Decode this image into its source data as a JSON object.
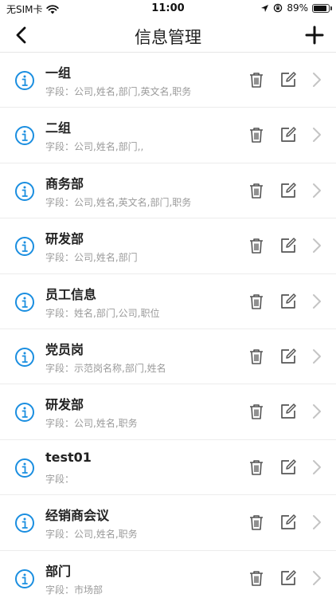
{
  "status": {
    "carrier": "无SIM卡",
    "time": "11:00",
    "battery": "89%",
    "battery_level": 0.89
  },
  "nav": {
    "title": "信息管理",
    "back_icon": "chevron-left-icon",
    "add_icon": "plus-icon"
  },
  "colors": {
    "accent": "#1a8ee0",
    "icon_gray": "#555555",
    "arrow_gray": "#c4c4c4"
  },
  "items": [
    {
      "name": "一组",
      "fields": "字段：公司,姓名,部门,英文名,职务"
    },
    {
      "name": "二组",
      "fields": "字段：公司,姓名,部门,,"
    },
    {
      "name": "商务部",
      "fields": "字段：公司,姓名,英文名,部门,职务"
    },
    {
      "name": "研发部",
      "fields": "字段：公司,姓名,部门"
    },
    {
      "name": "员工信息",
      "fields": "字段：姓名,部门,公司,职位"
    },
    {
      "name": "党员岗",
      "fields": "字段：示范岗名称,部门,姓名"
    },
    {
      "name": "研发部",
      "fields": "字段：公司,姓名,职务"
    },
    {
      "name": "test01",
      "fields": "字段："
    },
    {
      "name": "经销商会议",
      "fields": "字段：公司,姓名,职务"
    },
    {
      "name": "部门",
      "fields": "字段：市场部"
    }
  ]
}
